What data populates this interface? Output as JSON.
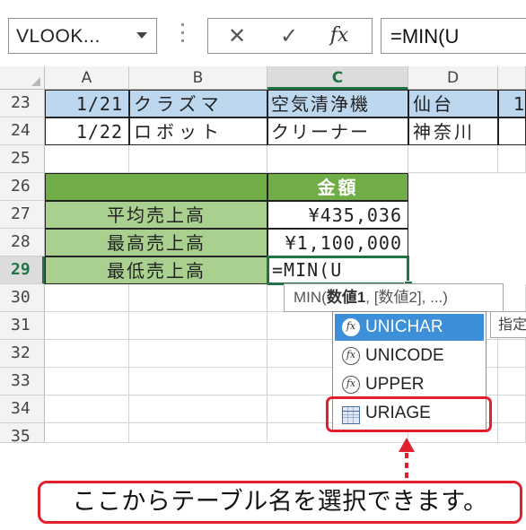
{
  "formula_bar": {
    "name_box": "VLOOK...",
    "cancel_symbol": "✕",
    "enter_symbol": "✓",
    "fx_symbol": "fx",
    "formula": "=MIN(U"
  },
  "columns": [
    "A",
    "B",
    "C",
    "D"
  ],
  "row_numbers": [
    "23",
    "24",
    "25",
    "26",
    "27",
    "28",
    "29",
    "30",
    "31",
    "32",
    "33",
    "34",
    "35"
  ],
  "rows": {
    "r23": {
      "a": "1/21",
      "b": "クラズマ",
      "c": "空気清浄機",
      "d": "仙台",
      "e": "1"
    },
    "r24": {
      "a": "1/22",
      "b": "ロボット",
      "c": "クリーナー",
      "d": "神奈川"
    },
    "r26": {
      "c": "金額"
    },
    "r27": {
      "label": "平均売上高",
      "value": "¥435,036"
    },
    "r28": {
      "label": "最高売上高",
      "value": "¥1,100,000"
    },
    "r29": {
      "label": "最低売上高",
      "value": "=MIN(U"
    }
  },
  "tooltip": {
    "fn": "MIN(",
    "arg1": "数値1",
    "rest": ", [数値2], ...)"
  },
  "autocomplete": {
    "items": [
      {
        "label": "UNICHAR",
        "icon": "function-icon"
      },
      {
        "label": "UNICODE",
        "icon": "function-icon"
      },
      {
        "label": "UPPER",
        "icon": "function-icon"
      },
      {
        "label": "URIAGE",
        "icon": "table-icon"
      }
    ],
    "side_tip": "指定"
  },
  "callout": {
    "text": "ここからテーブル名を選択できます。"
  },
  "colors": {
    "accent": "#217346",
    "highlight": "#e2202d",
    "selection_blue": "#3c8fd8"
  }
}
